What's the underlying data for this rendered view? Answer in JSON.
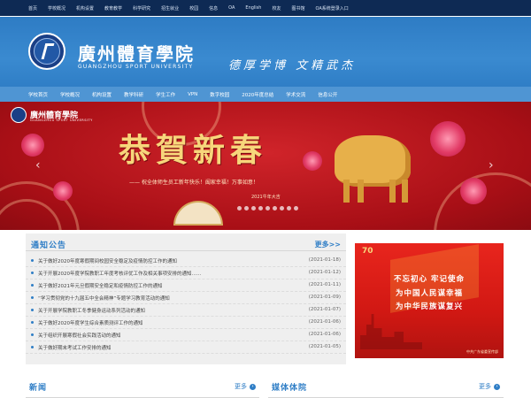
{
  "topbar": {
    "links": [
      "首页",
      "学校概况",
      "机构设置",
      "教育教学",
      "科学研究",
      "招生就业",
      "校园",
      "信息",
      "OA",
      "English",
      "校友",
      "图书馆",
      "OA系统登录入口"
    ]
  },
  "header": {
    "school_cn": "廣州體育學院",
    "school_en": "GUANGZHOU SPORT UNIVERSITY",
    "motto": "德厚学博  文精武杰"
  },
  "nav": {
    "items": [
      "学校首页",
      "学校概况",
      "机构设置",
      "教学科研",
      "学生工作",
      "VPN",
      "数字校园",
      "2020年度总结",
      "学术交流",
      "信息公开"
    ]
  },
  "banner": {
    "logo_cn": "廣州體育學院",
    "logo_en": "GUANGZHOU SPORT UNIVERSITY",
    "title": "恭賀新春",
    "subtitle": "—— 祝全体师生员工新年快乐！阖家幸福！万事如意！",
    "year": "2021牛年大吉",
    "prev_arrow": "‹",
    "next_arrow": "›"
  },
  "news": {
    "title": "通知公告",
    "more": "更多>>",
    "items": [
      {
        "text": "关于做好2020年度寒假期间校园安全稳定及疫情防控工作的通知",
        "date": "(2021-01-18)"
      },
      {
        "text": "关于开展2020年度学院教职工年度考核评优工作及相关事项安排的通知……",
        "date": "(2021-01-12)"
      },
      {
        "text": "关于做好2021年元旦假期安全稳定和疫情防控工作的通知",
        "date": "(2021-01-11)"
      },
      {
        "text": "“学习贯彻党的十九届五中全会精神”专题学习教育活动的通知",
        "date": "(2021-01-09)"
      },
      {
        "text": "关于开展学院教职工冬季健身运动系列活动的通知",
        "date": "(2021-01-07)"
      },
      {
        "text": "关于做好2020年度学生综合素质测评工作的通知",
        "date": "(2021-01-06)"
      },
      {
        "text": "关于组织开展寒假社会实践活动的通知",
        "date": "(2021-01-06)"
      },
      {
        "text": "关于做好期末考试工作安排的通知",
        "date": "(2021-01-05)"
      }
    ]
  },
  "poster": {
    "badge": "70",
    "line1": "不忘初心  牢记使命",
    "line2": "为中国人民谋幸福",
    "line3": "为中华民族谋复兴",
    "footer": "中共广东省委宣传部"
  },
  "sections": {
    "left": {
      "title": "新闻",
      "more": "更多"
    },
    "right": {
      "title": "媒体体院",
      "more": "更多"
    }
  },
  "colors": {
    "topbar": "#0e2a54",
    "header": "#2f7ec6",
    "nav": "#4f95d3",
    "accent": "#2f7ec6",
    "banner_red": "#b3141b",
    "banner_gold": "#f7d67b"
  }
}
